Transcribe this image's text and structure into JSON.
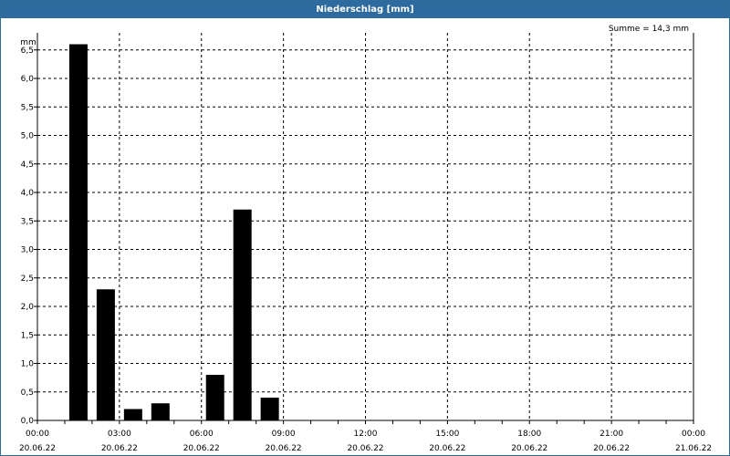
{
  "window": {
    "title": "Niederschlag [mm]"
  },
  "summary": {
    "text": "Summe = 14,3 mm"
  },
  "chart_data": {
    "type": "bar",
    "title": "Niederschlag [mm]",
    "ylabel": "mm",
    "xlabel": "",
    "ylim": [
      0,
      6.8
    ],
    "yticks": [
      "0,0",
      "0,5",
      "1,0",
      "1,5",
      "2,0",
      "2,5",
      "3,0",
      "3,5",
      "4,0",
      "4,5",
      "5,0",
      "5,5",
      "6,0",
      "6,5"
    ],
    "ytick_values": [
      0,
      0.5,
      1,
      1.5,
      2,
      2.5,
      3,
      3.5,
      4,
      4.5,
      5,
      5.5,
      6,
      6.5
    ],
    "x_range_hours": [
      0,
      24
    ],
    "xticks": [
      {
        "hour": 0,
        "time": "00:00",
        "date": "20.06.22"
      },
      {
        "hour": 3,
        "time": "03:00",
        "date": "20.06.22"
      },
      {
        "hour": 6,
        "time": "06:00",
        "date": "20.06.22"
      },
      {
        "hour": 9,
        "time": "09:00",
        "date": "20.06.22"
      },
      {
        "hour": 12,
        "time": "12:00",
        "date": "20.06.22"
      },
      {
        "hour": 15,
        "time": "15:00",
        "date": "20.06.22"
      },
      {
        "hour": 18,
        "time": "18:00",
        "date": "20.06.22"
      },
      {
        "hour": 21,
        "time": "21:00",
        "date": "20.06.22"
      },
      {
        "hour": 24,
        "time": "00:00",
        "date": "21.06.22"
      }
    ],
    "bars": [
      {
        "hour": 2,
        "value": 6.6
      },
      {
        "hour": 3,
        "value": 2.3
      },
      {
        "hour": 4,
        "value": 0.2
      },
      {
        "hour": 5,
        "value": 0.3
      },
      {
        "hour": 7,
        "value": 0.8
      },
      {
        "hour": 8,
        "value": 3.7
      },
      {
        "hour": 9,
        "value": 0.4
      }
    ],
    "bar_color": "#000000",
    "grid": true,
    "grid_style": "dashed"
  }
}
